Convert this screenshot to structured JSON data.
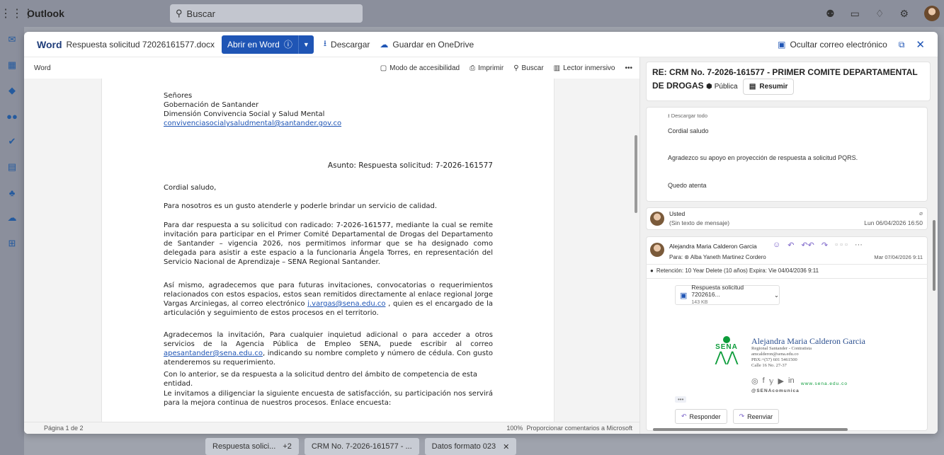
{
  "outlook": {
    "app_name": "Outlook",
    "search_placeholder": "Buscar",
    "search_icon": "search-icon",
    "top_icons": [
      "teams-icon",
      "whiteboard-icon",
      "bell-icon",
      "gear-icon",
      "avatar"
    ]
  },
  "left_rail": [
    "mail-icon",
    "calendar-icon",
    "copilot-icon",
    "people-icon",
    "todo-icon",
    "files-icon",
    "org-icon",
    "onedrive-icon",
    "apps-icon"
  ],
  "viewer_header": {
    "app": "Word",
    "file_name": "Respuesta solicitud 72026161577.docx",
    "open_button": "Abrir en Word",
    "download": "Descargar",
    "save_onedrive": "Guardar en OneDrive",
    "hide_email": "Ocultar correo electrónico"
  },
  "word_toolbar": {
    "label": "Word",
    "accessibility": "Modo de accesibilidad",
    "print": "Imprimir",
    "search": "Buscar",
    "reader": "Lector inmersivo",
    "more": "•••"
  },
  "document": {
    "addr1": "Señores",
    "addr2": "Gobernación de Santander",
    "addr3": "Dimensión Convivencia Social y Salud Mental",
    "addr_email": "convivenciasocialysaludmental@santander.gov.co",
    "asunto": "Asunto: Respuesta solicitud: 7-2026-161577",
    "greeting": "Cordial saludo,",
    "p1": "Para nosotros es un gusto atenderle y poderle brindar un servicio de calidad.",
    "p2": "Para dar respuesta a su solicitud con radicado: 7-2026-161577,  mediante la cual se remite invitación para participar en el Primer Comité Departamental de Drogas del Departamento de Santander – vigencia 2026, nos permitimos informar que se ha designado como delegada para asistir a este espacio a la funcionaria Ángela Torres, en representación del Servicio Nacional de Aprendizaje – SENA Regional Santander.",
    "p3a": "Así mismo, agradecemos que para futuras invitaciones, convocatorias o requerimientos relacionados con estos espacios, estos sean remitidos directamente al enlace regional Jorge Vargas Arciniegas, al correo electrónico ",
    "p3_email": "j.vargas@sena.edu.co",
    "p3b": " , quien es el encargado de la articulación y seguimiento de estos procesos en el territorio.",
    "p4a": "Agradecemos la invitación, Para cualquier inquietud adicional o para acceder a otros servicios de la Agencia Pública de Empleo SENA, puede escribir al correo ",
    "p4_email": "apesantander@sena.edu.co",
    "p4b": ", indicando su nombre completo y número de cédula. Con gusto atenderemos su requerimiento.",
    "p5": "Con lo anterior, se da respuesta a la solicitud dentro del ámbito de competencia de esta entidad.",
    "p6": "Le invitamos a diligenciar la siguiente encuesta de satisfacción, su participación nos servirá para la mejora continua de nuestros procesos. Enlace encuesta:"
  },
  "word_status": {
    "page": "Página 1 de 2",
    "zoom": "100%",
    "feedback": "Proporcionar comentarios a Microsoft"
  },
  "mail": {
    "subject": "RE: CRM No. 7-2026-161577 - PRIMER COMITE DEPARTAMENTAL DE DROGAS",
    "sensitivity": "Pública",
    "summarize": "Resumir",
    "download_all": "Descargar todo",
    "m1_line1": "Cordial saludo",
    "m1_line2": "Agradezco su apoyo en proyección de respuesta a solicitud PQRS.",
    "m1_line3": "Quedo atenta",
    "m2_sender": "Usted",
    "m2_preview": "(Sin texto de mensaje)",
    "m2_date": "Lun 06/04/2026 16:50",
    "m3_sender": "Alejandra Maria Calderon Garcia",
    "m3_to": "Para:  ⊛ Alba Yaneth Martinez Cordero",
    "m3_date": "Mar 07/04/2026 9:11",
    "retention": "Retención: 10 Year Delete (10 años) Expira: Vie 04/04/2036 9:11",
    "attachment_name": "Respuesta solicitud 7202616...",
    "attachment_size": "143 KB",
    "sig_name": "Alejandra Maria Calderon Garcia",
    "sig_line1": "Regional Santander - Contratista",
    "sig_line2": "amcalderon@sena.edu.co",
    "sig_line3": "PBX:+(57) 601 5461500",
    "sig_line4": "Calle 16 No. 27-37",
    "sig_web": "www.sena.edu.co",
    "sig_handle": "@SENAcomunica",
    "sena_logo": "SENA",
    "more": "•••",
    "reply": "Responder",
    "forward": "Reenviar"
  },
  "taskbar": {
    "t1": "Respuesta solici...",
    "t1_extra": "+2",
    "t2": "CRM No. 7-2026-161577 - ...",
    "t3": "Datos formato 023"
  },
  "colors": {
    "accent": "#1f55b5",
    "sena_green": "#0c9c3a",
    "sig_name": "#2b4f8f"
  }
}
